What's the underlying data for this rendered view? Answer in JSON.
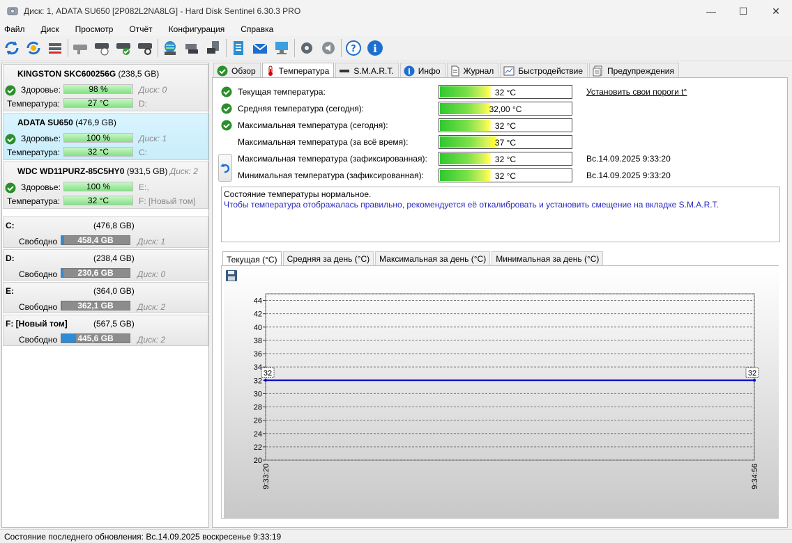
{
  "window": {
    "title": "Диск: 1, ADATA SU650 [2P082L2NA8LG]  -  Hard Disk Sentinel 6.30.3 PRO",
    "icon": "hard-disk-app-icon"
  },
  "menu": [
    "Файл",
    "Диск",
    "Просмотр",
    "Отчёт",
    "Конфигурация",
    "Справка"
  ],
  "toolbar": {
    "buttons": [
      "refresh-icon",
      "refresh-all-icon",
      "disk-list-icon",
      "disk-sleep-icon",
      "disk-schedule-icon",
      "disk-test-ok-icon",
      "disk-surface-test-icon",
      "web-update-icon",
      "network-disk-icon",
      "usb-disk-icon",
      "report-icon",
      "email-icon",
      "network-computer-icon",
      "settings-icon",
      "sound-icon",
      "help-icon",
      "info-icon"
    ]
  },
  "disks": [
    {
      "name": "KINGSTON SKC600256G",
      "size": "(238,5 GB)",
      "disk_no": "",
      "health_label": "Здоровье:",
      "health": "98 %",
      "health_value": 98,
      "health_right": "Диск: 0",
      "temp_label": "Температура:",
      "temp": "27 °C",
      "temp_right": "D:"
    },
    {
      "name": "ADATA SU650",
      "size": "(476,9 GB)",
      "disk_no": "",
      "health_label": "Здоровье:",
      "health": "100 %",
      "health_value": 100,
      "health_right": "Диск: 1",
      "temp_label": "Температура:",
      "temp": "32 °C",
      "temp_right": "C:"
    },
    {
      "name": "WDC WD11PURZ-85C5HY0",
      "size": "(931,5 GB)",
      "disk_no": "Диск: 2",
      "health_label": "Здоровье:",
      "health": "100 %",
      "health_value": 100,
      "health_right": "E:,",
      "temp_label": "Температура:",
      "temp": "32 °C",
      "temp_right": "F: [Новый том]"
    }
  ],
  "volumes": [
    {
      "letter": "C:",
      "size": "(476,8 GB)",
      "free_label": "Свободно",
      "free": "458,4 GB",
      "free_value": 458.4,
      "total_value": 476.8,
      "disk": "Диск: 1"
    },
    {
      "letter": "D:",
      "size": "(238,4 GB)",
      "free_label": "Свободно",
      "free": "230,6 GB",
      "free_value": 230.6,
      "total_value": 238.4,
      "disk": "Диск: 0"
    },
    {
      "letter": "E:",
      "size": "(364,0 GB)",
      "free_label": "Свободно",
      "free": "362,1 GB",
      "free_value": 362.1,
      "total_value": 364.0,
      "disk": "Диск: 2"
    },
    {
      "letter": "F: [Новый том]",
      "size": "(567,5 GB)",
      "free_label": "Свободно",
      "free": "445,6 GB",
      "free_value": 445.6,
      "total_value": 567.5,
      "disk": "Диск: 2"
    }
  ],
  "tabs": [
    {
      "label": "Обзор",
      "icon": "check-circle-icon"
    },
    {
      "label": "Температура",
      "icon": "thermometer-icon",
      "active": true
    },
    {
      "label": "S.M.A.R.T.",
      "icon": "disk-icon"
    },
    {
      "label": "Инфо",
      "icon": "info-icon"
    },
    {
      "label": "Журнал",
      "icon": "document-icon"
    },
    {
      "label": "Быстродействие",
      "icon": "chart-icon"
    },
    {
      "label": "Предупреждения",
      "icon": "alerts-icon"
    }
  ],
  "temperature": {
    "threshold_link": "Установить свои пороги t°",
    "rows": [
      {
        "label": "Текущая температура:",
        "value": "32 °C",
        "check": true,
        "time": ""
      },
      {
        "label": "Средняя температура (сегодня):",
        "value": "32,00 °C",
        "check": true,
        "time": ""
      },
      {
        "label": "Максимальная температура (сегодня):",
        "value": "32 °C",
        "check": true,
        "time": ""
      },
      {
        "label": "Максимальная температура (за всё время):",
        "value": "37 °C",
        "check": false,
        "time": ""
      },
      {
        "label": "Максимальная температура (зафиксированная):",
        "value": "32 °C",
        "check": false,
        "time": "Вс.14.09.2025 9:33:20"
      },
      {
        "label": "Минимальная температура (зафиксированная):",
        "value": "32 °C",
        "check": false,
        "time": "Вс.14.09.2025 9:33:20"
      }
    ],
    "message_line1": "Состояние температуры нормальное.",
    "message_line2": "Чтобы температура отображалась правильно, рекомендуется её откалибровать и установить смещение на вкладке S.M.A.R.T."
  },
  "graph_tabs": [
    "Текущая (°C)",
    "Средняя за день (°C)",
    "Максимальная за день (°C)",
    "Минимальная за день (°C)"
  ],
  "chart_data": {
    "type": "line",
    "x": [
      "9:33:20",
      "9:34:56"
    ],
    "series": [
      {
        "values": [
          32,
          32
        ]
      }
    ],
    "point_labels": [
      "32",
      "32"
    ],
    "y_ticks": [
      "20",
      "22",
      "24",
      "26",
      "28",
      "30",
      "32",
      "34",
      "36",
      "38",
      "40",
      "42",
      "44"
    ],
    "ylim": [
      20,
      45
    ],
    "grid": true,
    "line_color": "#0000c8",
    "title": "",
    "xlabel": "",
    "ylabel": ""
  },
  "status": "Состояние последнего обновления: Вс.14.09.2025 воскресенье 9:33:19"
}
